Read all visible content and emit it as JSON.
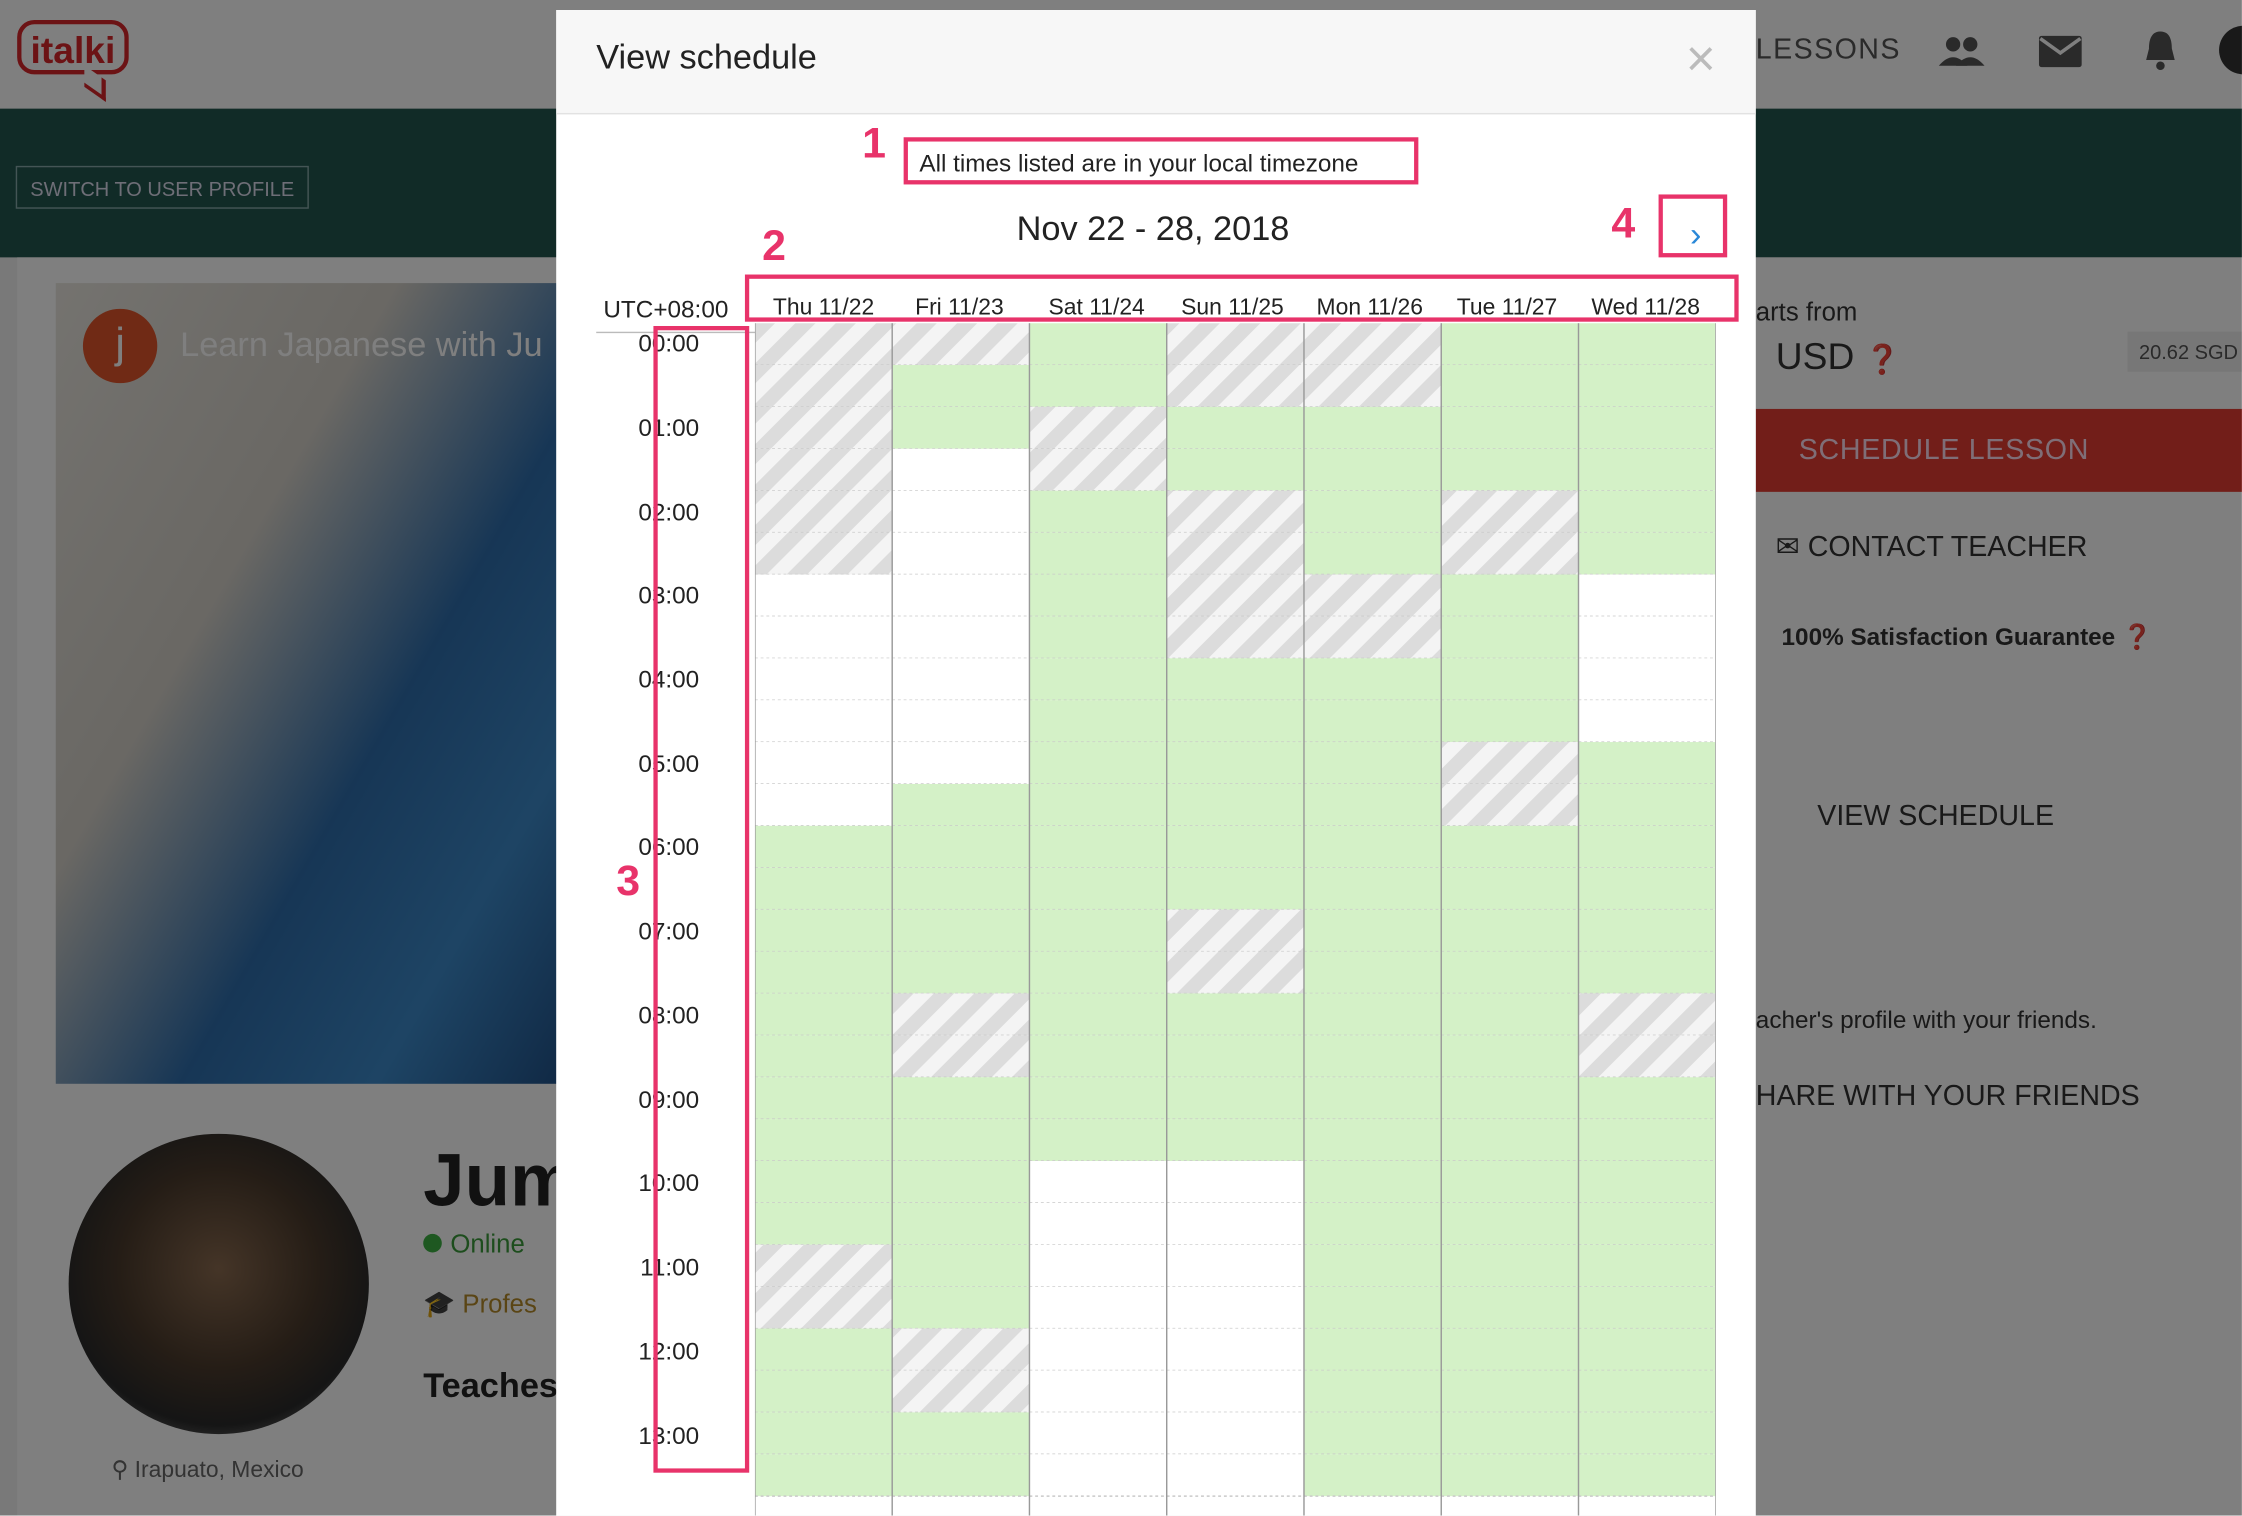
{
  "app": {
    "logo_text": "italki"
  },
  "nav": {
    "lessons_label": "LESSONS"
  },
  "profile_bg": {
    "switch_label": "SWITCH TO USER PROFILE",
    "video_title": "Learn Japanese with Ju",
    "video_initial": "j",
    "teacher_name": "Jum",
    "status": "Online",
    "profession": "Profes",
    "teaches": "Teaches",
    "location": "Irapuato, Mexico"
  },
  "sidebar": {
    "starts_from": "arts from",
    "price": "USD",
    "price_alt": "20.62 SGD",
    "schedule_lesson": "SCHEDULE LESSON",
    "contact_teacher": "CONTACT TEACHER",
    "guarantee": "100% Satisfaction Guarantee",
    "view_schedule": "VIEW SCHEDULE",
    "share_text": "acher's profile with your friends.",
    "share_button": "HARE WITH YOUR FRIENDS"
  },
  "modal": {
    "title": "View schedule",
    "close_label": "×",
    "timezone_note": "All times listed are in your local timezone",
    "date_range": "Nov 22 - 28, 2018",
    "next_label": "›",
    "utc_label": "UTC+08:00"
  },
  "annotations": [
    "1",
    "2",
    "3",
    "4"
  ],
  "days": [
    "Thu 11/22",
    "Fri 11/23",
    "Sat 11/24",
    "Sun 11/25",
    "Mon 11/26",
    "Tue 11/27",
    "Wed 11/28"
  ],
  "times": [
    "00:00",
    "01:00",
    "02:00",
    "03:00",
    "04:00",
    "05:00",
    "06:00",
    "07:00",
    "08:00",
    "09:00",
    "10:00",
    "11:00",
    "12:00",
    "13:00"
  ],
  "legend_colors": {
    "available": "#d4f1c7",
    "booked": "#e2e2e2",
    "unavailable": "#ffffff"
  },
  "schedule_rows": [
    "hhGhhGG",
    "hGGhhGG",
    "hGhGGGG",
    "hWhGGGG",
    "hWGhGhG",
    "hWGhGhG",
    "WWGhhGW",
    "WWGhhGW",
    "WWGGGGW",
    "WWGGGGW",
    "WWGGGhG",
    "WGGGGhG",
    "GGGGGGG",
    "GGGGGGG",
    "GGGhGGG",
    "GGGhGGG",
    "GhGGGGh",
    "GhGGGGh",
    "GGGGGGG",
    "GGGGGGG",
    "GGWWGGG",
    "GGWWGGG",
    "hGWWGGG",
    "hGWWGGG",
    "GhWWGGG",
    "GhWWGGG",
    "GGWWGGG",
    "GGWWGGG"
  ]
}
